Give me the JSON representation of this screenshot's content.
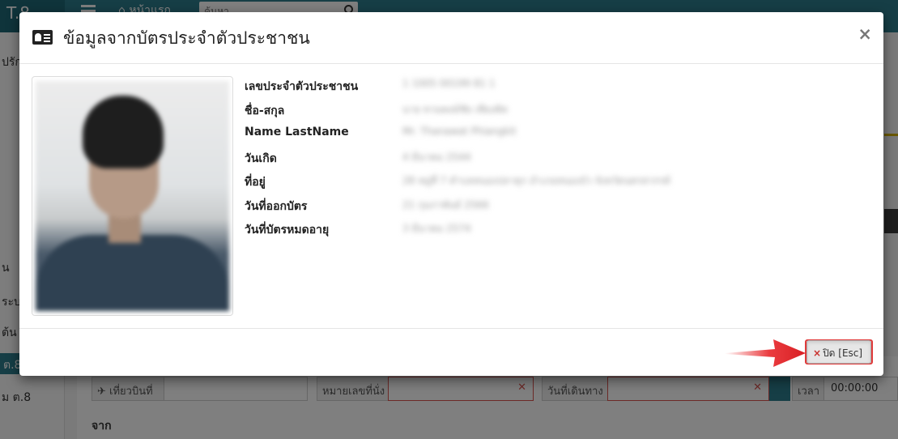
{
  "background": {
    "brand": "T.8",
    "home_label": "หน้าแรก",
    "search_placeholder": "ค้นหา",
    "sidebar_items": [
      "ปรัก",
      "น",
      "ระบ",
      "ต้น",
      "ต.8",
      "ม ต.8"
    ],
    "form": {
      "flight_label": "เที่ยวบินที่",
      "seat_label": "หมายเลขที่นั่ง",
      "travel_date_label": "วันที่เดินทาง",
      "time_label": "เวลา",
      "time_value": "00:00:00"
    },
    "from_label": "จาก"
  },
  "modal": {
    "icon": "id-card-icon",
    "title": "ข้อมูลจากบัตรประจำตัวประชาชน",
    "close_symbol": "×",
    "fields": [
      {
        "label": "เลขประจำตัวประชาชน",
        "value": "1 1005 00199 81 1"
      },
      {
        "label": "ชื่อ-สกุล",
        "value": "นาย ทวนพงษ์ชัย เพียงคิด"
      },
      {
        "label": "Name LastName",
        "value": "Mr. Thanawat Phiangkit"
      },
      {
        "label": "วันเกิด",
        "value": "4 มีนาคม 2544"
      },
      {
        "label": "ที่อยู่",
        "value": "28 หมู่ที่ 7 ตำบลหนองปลาดุก อำเภอหนองบัว จังหวัดนครสวรรค์"
      },
      {
        "label": "วันที่ออกบัตร",
        "value": "21 กุมภาพันธ์ 2566"
      },
      {
        "label": "วันที่บัตรหมดอายุ",
        "value": "3 มีนาคม 2574"
      }
    ],
    "close_button": {
      "icon": "×",
      "label": "ปิด [Esc]"
    }
  },
  "colors": {
    "accent": "#2c7d8c",
    "danger": "#d9534f",
    "arrow": "#e8262a"
  }
}
